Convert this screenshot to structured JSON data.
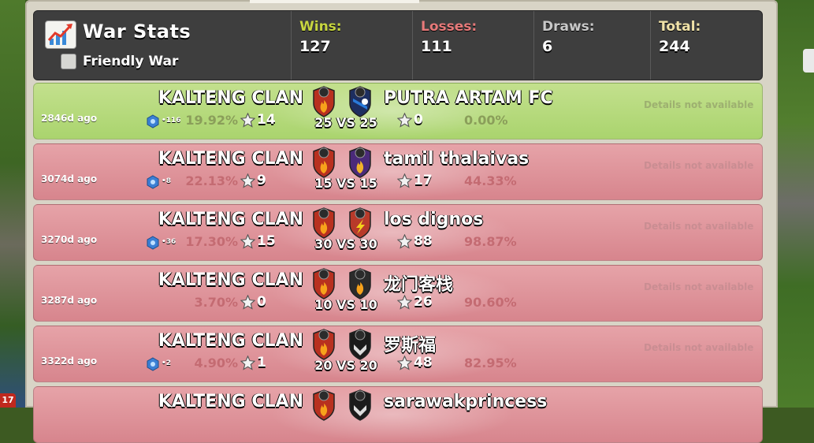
{
  "header": {
    "title": "War Stats",
    "friendly_war_label": "Friendly War",
    "wins_label": "Wins:",
    "wins_value": "127",
    "losses_label": "Losses:",
    "losses_value": "111",
    "draws_label": "Draws:",
    "draws_value": "6",
    "total_label": "Total:",
    "total_value": "244",
    "colors": {
      "wins": "#c8d640",
      "losses": "#e77a7a",
      "draws": "#c9c9c9",
      "total": "#f0e2a8"
    }
  },
  "edge_badge": "17",
  "wars": [
    {
      "result": "win",
      "ago": "2846d ago",
      "league": "•116",
      "our_pct": "19.92%",
      "our_stars": "14",
      "our_clan": "KALTENG CLAN",
      "our_level": "8",
      "opp_level": "3",
      "vs": "25 VS 25",
      "opp_clan": "PUTRA ARTAM FC",
      "opp_stars": "0",
      "opp_pct": "0.00%",
      "details": "Details not available"
    },
    {
      "result": "loss",
      "ago": "3074d ago",
      "league": "•8",
      "our_pct": "22.13%",
      "our_stars": "9",
      "our_clan": "KALTENG CLAN",
      "our_level": "8",
      "opp_level": "2",
      "vs": "15 VS 15",
      "opp_clan": "tamil thalaivas",
      "opp_stars": "17",
      "opp_pct": "44.33%",
      "details": "Details not available"
    },
    {
      "result": "loss",
      "ago": "3270d ago",
      "league": "•36",
      "our_pct": "17.30%",
      "our_stars": "15",
      "our_clan": "KALTENG CLAN",
      "our_level": "8",
      "opp_level": "4",
      "vs": "30 VS 30",
      "opp_clan": "los dignos",
      "opp_stars": "88",
      "opp_pct": "98.87%",
      "details": "Details not available"
    },
    {
      "result": "loss",
      "ago": "3287d ago",
      "league": "",
      "our_pct": "3.70%",
      "our_stars": "0",
      "our_clan": "KALTENG CLAN",
      "our_level": "8",
      "opp_level": "4",
      "vs": "10 VS 10",
      "opp_clan": "龙门客栈",
      "opp_stars": "26",
      "opp_pct": "90.60%",
      "details": "Details not available"
    },
    {
      "result": "loss",
      "ago": "3322d ago",
      "league": "•2",
      "our_pct": "4.90%",
      "our_stars": "1",
      "our_clan": "KALTENG CLAN",
      "our_level": "8",
      "opp_level": "6",
      "vs": "20 VS 20",
      "opp_clan": "罗斯福",
      "opp_stars": "48",
      "opp_pct": "82.95%",
      "details": "Details not available"
    },
    {
      "result": "loss",
      "ago": "",
      "league": "",
      "our_pct": "",
      "our_stars": "",
      "our_clan": "KALTENG CLAN",
      "our_level": "8",
      "opp_level": "6",
      "vs": "",
      "opp_clan": "sarawakprincess",
      "opp_stars": "",
      "opp_pct": "",
      "details": ""
    }
  ]
}
